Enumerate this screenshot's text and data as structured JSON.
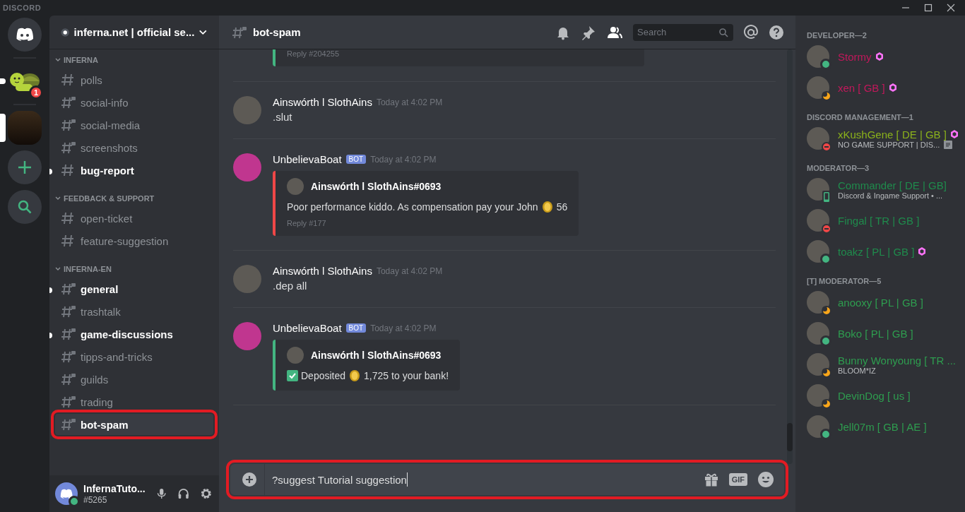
{
  "titlebar": {
    "logo": "DISCORD"
  },
  "servers": [
    {
      "kind": "emoji",
      "badge": "1",
      "unread": true,
      "selected": false
    },
    {
      "kind": "image",
      "unread": false,
      "selected": true
    }
  ],
  "server": {
    "name": "inferna.net | official se..."
  },
  "categories": [
    {
      "name": "INFERNA",
      "channels": [
        {
          "name": "polls",
          "locked": false,
          "unread": false,
          "selected": false,
          "highlighted": false
        },
        {
          "name": "social-info",
          "locked": true,
          "unread": false,
          "selected": false,
          "highlighted": false
        },
        {
          "name": "social-media",
          "locked": true,
          "unread": false,
          "selected": false,
          "highlighted": false
        },
        {
          "name": "screenshots",
          "locked": true,
          "unread": false,
          "selected": false,
          "highlighted": false
        },
        {
          "name": "bug-report",
          "locked": false,
          "unread": true,
          "selected": false,
          "highlighted": false
        }
      ]
    },
    {
      "name": "FEEDBACK & SUPPORT",
      "channels": [
        {
          "name": "open-ticket",
          "locked": false,
          "unread": false,
          "selected": false,
          "highlighted": false
        },
        {
          "name": "feature-suggestion",
          "locked": false,
          "unread": false,
          "selected": false,
          "highlighted": false
        }
      ]
    },
    {
      "name": "INFERNA-EN",
      "channels": [
        {
          "name": "general",
          "locked": true,
          "unread": true,
          "selected": false,
          "highlighted": false
        },
        {
          "name": "trashtalk",
          "locked": true,
          "unread": false,
          "selected": false,
          "highlighted": false
        },
        {
          "name": "game-discussions",
          "locked": true,
          "unread": true,
          "selected": false,
          "highlighted": false
        },
        {
          "name": "tipps-and-tricks",
          "locked": true,
          "unread": false,
          "selected": false,
          "highlighted": false
        },
        {
          "name": "guilds",
          "locked": true,
          "unread": false,
          "selected": false,
          "highlighted": false
        },
        {
          "name": "trading",
          "locked": true,
          "unread": false,
          "selected": false,
          "highlighted": false
        },
        {
          "name": "bot-spam",
          "locked": true,
          "unread": false,
          "selected": true,
          "highlighted": true
        }
      ]
    }
  ],
  "user": {
    "name": "InfernaTuto...",
    "tag": "#5265",
    "kind": "online"
  },
  "channel_header": {
    "name": "bot-spam",
    "locked": true
  },
  "search": {
    "placeholder": "Search"
  },
  "messages": [
    {
      "embed": {
        "color": "#43b581",
        "footer": "Reply #204255"
      }
    },
    {
      "author": "Ainswórth l SlothAins",
      "time": "Today at 4:02 PM",
      "text": ".slut"
    },
    {
      "author": "UnbelievaBoat",
      "bot_label": "BOT",
      "time": "Today at 4:02 PM",
      "embed": {
        "color": "#f04747",
        "author": "Ainswórth l SlothAins#0693",
        "lines": [
          {
            "check": false,
            "before": "Poor performance kiddo. As compensation pay your John",
            "amount": "56"
          }
        ],
        "footer": "Reply #177"
      }
    },
    {
      "author": "Ainswórth l SlothAins",
      "time": "Today at 4:02 PM",
      "text": ".dep all"
    },
    {
      "author": "UnbelievaBoat",
      "bot_label": "BOT",
      "time": "Today at 4:02 PM",
      "embed": {
        "color": "#43b581",
        "author": "Ainswórth l SlothAins#0693",
        "lines": [
          {
            "check": true,
            "before": "Deposited",
            "amount": "1,725",
            "after": "to your bank!"
          }
        ]
      }
    }
  ],
  "composer": {
    "value": "?suggest Tutorial suggestion",
    "highlighted": true,
    "gif_label": "GIF"
  },
  "member_groups": [
    {
      "name": "DEVELOPER—2",
      "members": [
        {
          "name": "Stormy",
          "color": "#c2185b",
          "kind": "online",
          "booster": true
        },
        {
          "name": "xen [ GB ]",
          "color": "#c2185b",
          "kind": "idle",
          "booster": true
        }
      ]
    },
    {
      "name": "DISCORD MANAGEMENT—1",
      "members": [
        {
          "name": "xKushGene [ DE | GB ]",
          "color": "#8bb21b",
          "kind": "dnd",
          "booster": true,
          "activity": "NO GAME SUPPORT | DIS..."
        }
      ]
    },
    {
      "name": "MODERATOR—3",
      "members": [
        {
          "name": "Commander [ DE | GB]",
          "color": "#1f8b4c",
          "kind": "mobile",
          "booster": false,
          "activity": "Discord & Ingame Support • ..."
        },
        {
          "name": "Fingal [ TR | GB ]",
          "color": "#1f8b4c",
          "kind": "dnd",
          "booster": false
        },
        {
          "name": "toakz [ PL | GB ]",
          "color": "#1f8b4c",
          "kind": "online",
          "booster": true
        }
      ]
    },
    {
      "name": "[T] MODERATOR—5",
      "members": [
        {
          "name": "anooxy [ PL | GB ]",
          "color": "#2e9d4f",
          "kind": "idle",
          "booster": false
        },
        {
          "name": "Boko [ PL | GB ]",
          "color": "#2e9d4f",
          "kind": "online",
          "booster": false
        },
        {
          "name": "Bunny Wonyoung [ TR ...",
          "color": "#2e9d4f",
          "kind": "idle",
          "booster": false,
          "activity": "BLOOM*IZ"
        },
        {
          "name": "DevinDog [ us ]",
          "color": "#2e9d4f",
          "kind": "idle",
          "booster": false
        },
        {
          "name": "Jell07m [ GB | AE ]",
          "color": "#2e9d4f",
          "kind": "online",
          "booster": false
        }
      ]
    }
  ]
}
